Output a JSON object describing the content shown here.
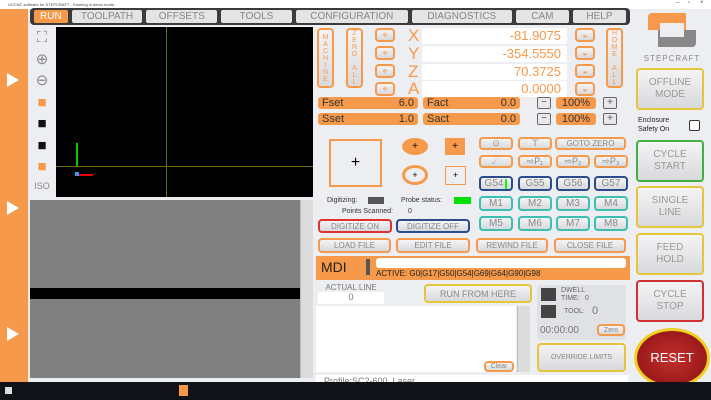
{
  "window": {
    "title": "UCCNC software for STEPCRAFT - Running in demo mode..."
  },
  "tabs": [
    "RUN",
    "TOOLPATH",
    "OFFSETS",
    "TOOLS",
    "CONFIGURATION",
    "DIAGNOSTICS",
    "CAM",
    "HELP"
  ],
  "view_tools": {
    "iso_label": "ISO"
  },
  "axes": {
    "machine_label": "MACHINE",
    "zero_all_label": "ZERO ALL",
    "home_all_label": "HOME ALL",
    "rows": [
      {
        "name": "X",
        "value": "-81.9075"
      },
      {
        "name": "Y",
        "value": "-354.5550"
      },
      {
        "name": "Z",
        "value": "70.3725"
      },
      {
        "name": "A",
        "value": "0.0000"
      }
    ]
  },
  "feed": {
    "fset_label": "Fset",
    "fset": "6.0",
    "fact_label": "Fact",
    "fact": "0.0",
    "override": "100%"
  },
  "spindle": {
    "sset_label": "Sset",
    "sset": "1.0",
    "sact_label": "Sact",
    "sact": "0.0",
    "override": "100%"
  },
  "buttons": {
    "goto_zero": "GOTO ZERO",
    "p1": "⇨P₁",
    "p2": "⇨P₂",
    "p3": "⇨P₃",
    "g": [
      "G54",
      "G55",
      "G56",
      "G57"
    ],
    "m": [
      "M1",
      "M2",
      "M3",
      "M4",
      "M5",
      "M6",
      "M7",
      "M8"
    ],
    "digitize_on": "DIGITIZE ON",
    "digitize_off": "DIGITIZE OFF",
    "load_file": "LOAD FILE",
    "edit_file": "EDIT FILE",
    "rewind_file": "REWIND FILE",
    "close_file": "CLOSE FILE",
    "run_from_here": "RUN FROM HERE",
    "clear": "Clear",
    "zero": "Zero",
    "override_limits": "OVERRIDE LIMITS"
  },
  "digitize": {
    "digitizing_label": "Digitizing:",
    "probe_status_label": "Probe status:",
    "points_scanned_label": "Points Scanned:",
    "points_scanned": "0",
    "probe_color": "#00e000"
  },
  "mdi": {
    "label": "MDI",
    "value": "",
    "active": "ACTIVE: G0|G17|G50|G54|G69|G64|G90|G98"
  },
  "actual_line": {
    "label": "ACTUAL LINE",
    "value": "0"
  },
  "status": {
    "dwell_label": "DWELL",
    "time_label": "TIME:",
    "dwell_time": "0",
    "tool_label": "TOOL:",
    "tool": "0",
    "timer": "00:00:00"
  },
  "profile": "Profile:SC2-600_Laser",
  "sidebar": {
    "brand": "STEPCRAFT",
    "offline": [
      "OFFLINE",
      "MODE"
    ],
    "enclosure": [
      "Enclosure",
      "Safety On"
    ],
    "cycle_start": [
      "CYCLE",
      "START"
    ],
    "single_line": [
      "SINGLE",
      "LINE"
    ],
    "feed_hold": [
      "FEED",
      "HOLD"
    ],
    "cycle_stop": [
      "CYCLE",
      "STOP"
    ],
    "reset": "RESET"
  },
  "colors": {
    "accent": "#f7994a"
  }
}
